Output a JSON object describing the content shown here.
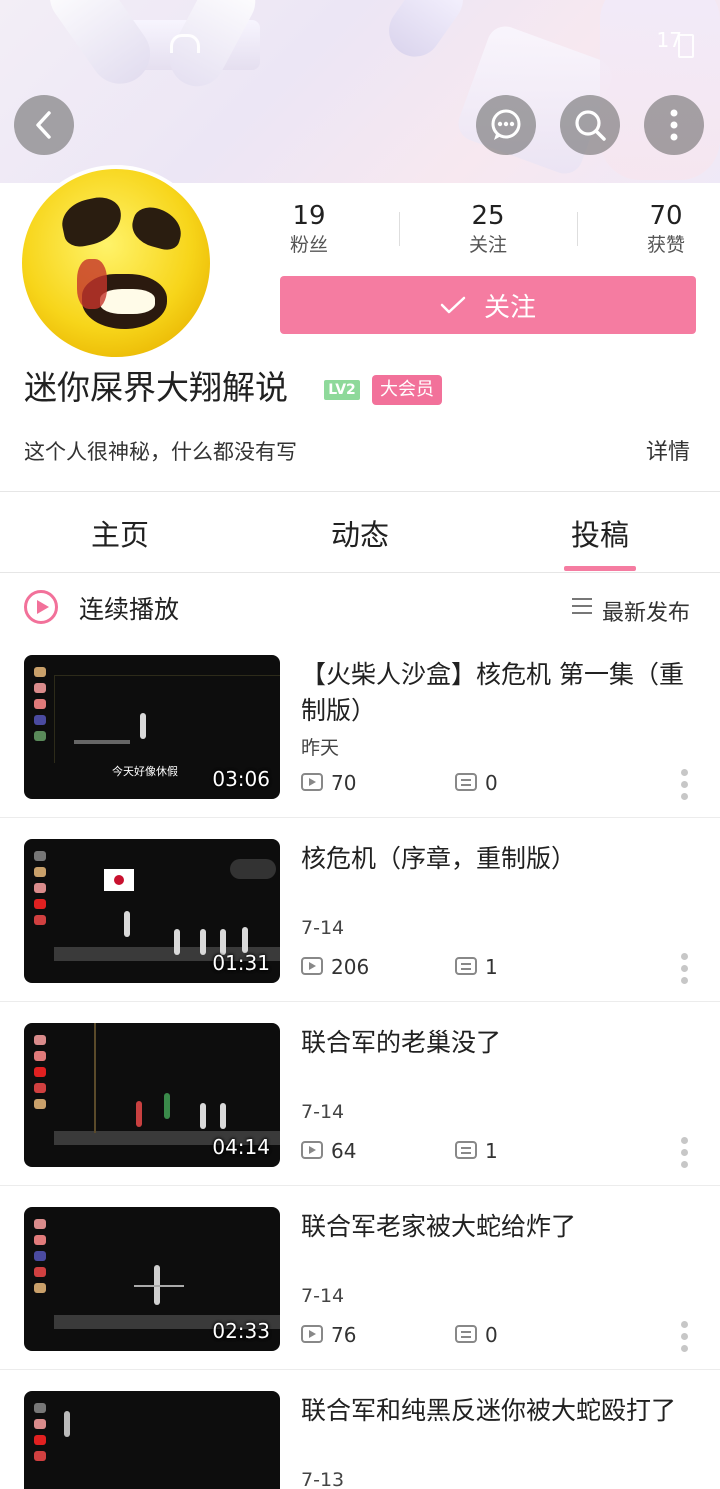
{
  "status": {
    "time": "17"
  },
  "profile": {
    "username": "迷你屎界大翔解说",
    "level": "LV2",
    "vip": "大会员",
    "bio": "这个人很神秘，什么都没有写",
    "detail": "详情",
    "stats": {
      "fans": {
        "value": "19",
        "label": "粉丝"
      },
      "following": {
        "value": "25",
        "label": "关注"
      },
      "likes": {
        "value": "70",
        "label": "获赞"
      }
    },
    "follow_button": "关注"
  },
  "tabs": [
    {
      "label": "主页",
      "active": false
    },
    {
      "label": "动态",
      "active": false
    },
    {
      "label": "投稿",
      "active": true
    }
  ],
  "accent_color": "#f57ca1",
  "play_all": "连续播放",
  "sort": "最新发布",
  "videos": [
    {
      "title": "【火柴人沙盒】核危机 第一集（重制版）",
      "date": "昨天",
      "duration": "03:06",
      "plays": "70",
      "comments": "0",
      "caption": "今天好像休假"
    },
    {
      "title": "核危机（序章，重制版）",
      "date": "7-14",
      "duration": "01:31",
      "plays": "206",
      "comments": "1"
    },
    {
      "title": "联合军的老巢没了",
      "date": "7-14",
      "duration": "04:14",
      "plays": "64",
      "comments": "1"
    },
    {
      "title": "联合军老家被大蛇给炸了",
      "date": "7-14",
      "duration": "02:33",
      "plays": "76",
      "comments": "0"
    },
    {
      "title": "联合军和纯黑反迷你被大蛇殴打了",
      "date": "7-13",
      "duration": "",
      "plays": "",
      "comments": ""
    }
  ]
}
